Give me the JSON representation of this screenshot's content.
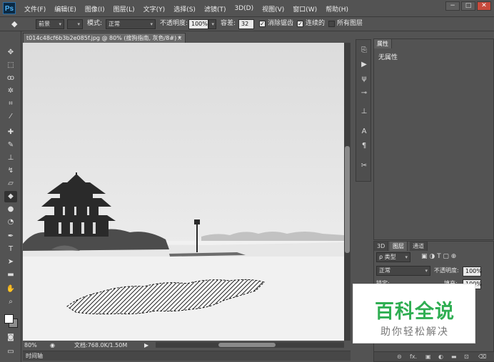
{
  "app": {
    "logo": "Ps"
  },
  "menu": [
    "文件(F)",
    "编辑(E)",
    "图像(I)",
    "图层(L)",
    "文字(Y)",
    "选择(S)",
    "滤镜(T)",
    "3D(D)",
    "视图(V)",
    "窗口(W)",
    "帮助(H)"
  ],
  "window_controls": {
    "minimize": "−",
    "maximize": "□",
    "close": "✕"
  },
  "options": {
    "sample_label": "前景",
    "mode_label": "模式:",
    "mode_value": "正常",
    "opacity_label": "不透明度:",
    "opacity_value": "100%",
    "tolerance_label": "容差:",
    "tolerance_value": "32",
    "antialias_label": "消除锯齿",
    "contiguous_label": "连续的",
    "all_layers_label": "所有图层"
  },
  "document": {
    "tab_title": "t014c48cf6b3b2e085f.jpg @ 80% (搜狗指南, 灰色/8#) *",
    "tab_close": "×"
  },
  "statusbar": {
    "zoom": "80%",
    "doc_info": "文档:768.0K/1.50M",
    "arrow": "▶"
  },
  "timeline_label": "时间轴",
  "properties_panel": {
    "tab": "属性",
    "content": "无属性"
  },
  "layers_panel": {
    "tabs": [
      "3D",
      "图层",
      "通道"
    ],
    "kind_label": "ρ 类型",
    "blend_mode": "正常",
    "opacity_label": "不透明度:",
    "opacity_value": "100%",
    "lock_label": "锁定:",
    "fill_label": "填充:",
    "fill_value": "100%"
  },
  "watermark": {
    "title": "百科全说",
    "subtitle": "助你轻松解决"
  },
  "colors": {
    "ui_bg": "#535353",
    "panel_border": "#3a3a3a",
    "watermark_green": "#2fae52"
  }
}
